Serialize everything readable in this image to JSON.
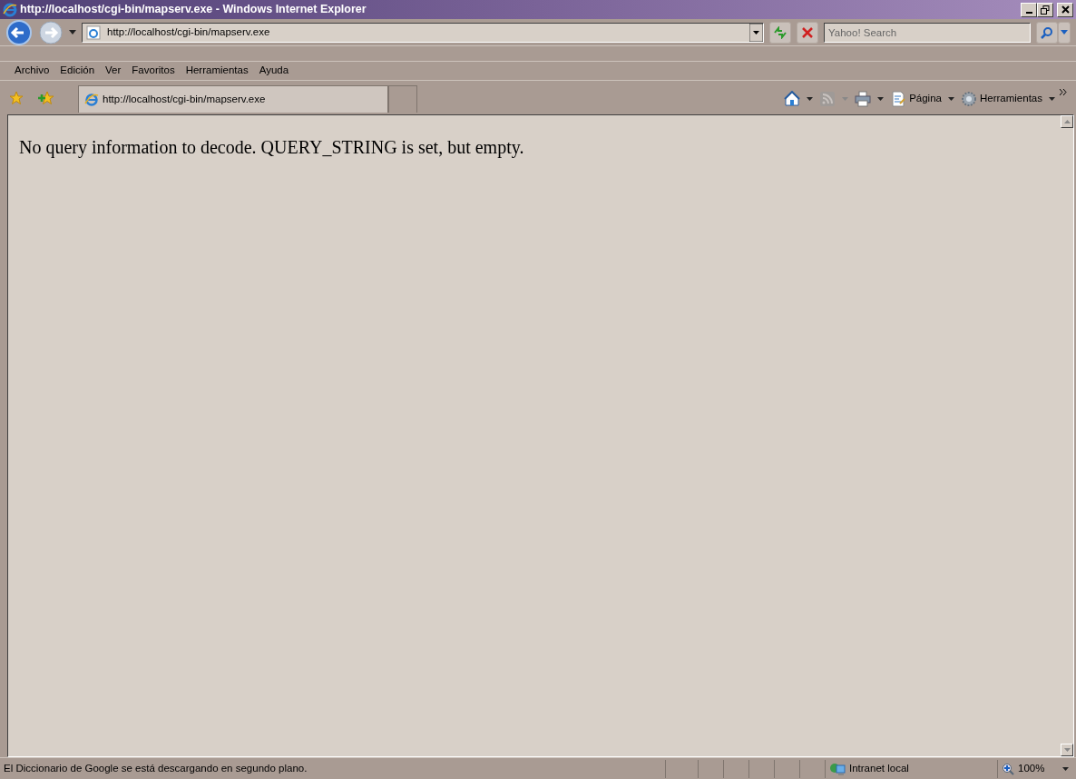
{
  "window": {
    "title": "http://localhost/cgi-bin/mapserv.exe - Windows Internet Explorer"
  },
  "address_bar": {
    "value": "http://localhost/cgi-bin/mapserv.exe"
  },
  "search": {
    "placeholder": "Yahoo! Search"
  },
  "menu": [
    {
      "label": "Archivo"
    },
    {
      "label": "Edición"
    },
    {
      "label": "Ver"
    },
    {
      "label": "Favoritos"
    },
    {
      "label": "Herramientas"
    },
    {
      "label": "Ayuda"
    }
  ],
  "tabs": [
    {
      "label": "http://localhost/cgi-bin/mapserv.exe",
      "selected": true
    },
    {
      "kind": "new-tab",
      "selected": false
    }
  ],
  "command_bar": [
    {
      "kind": "home"
    },
    {
      "kind": "feeds",
      "disabled": true
    },
    {
      "kind": "print"
    },
    {
      "kind": "page",
      "label": "Página"
    },
    {
      "kind": "tools",
      "label": "Herramientas"
    }
  ],
  "content": {
    "text": "No query information to decode. QUERY_STRING is set, but empty."
  },
  "status_bar": {
    "text": "El Diccionario de Google se está descargando en segundo plano.",
    "zone": "Intranet local",
    "zoom": "100%"
  }
}
